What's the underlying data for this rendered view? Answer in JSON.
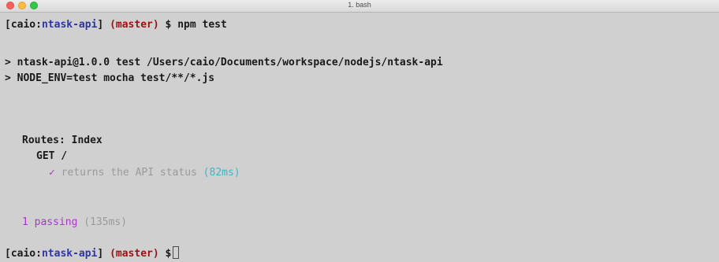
{
  "window": {
    "title": "1. bash",
    "colors": {
      "close": "#fc605c",
      "minimize": "#fdbc40",
      "maximize": "#34c84a"
    }
  },
  "terminal": {
    "prompt1": {
      "open": "[",
      "user": "caio",
      "sep": ":",
      "dir": "ntask-api",
      "close": "]",
      "branch": "(master)",
      "dollar": "$",
      "command": "npm test"
    },
    "script_lines": [
      "> ntask-api@1.0.0 test /Users/caio/Documents/workspace/nodejs/ntask-api",
      "> NODE_ENV=test mocha test/**/*.js"
    ],
    "suite": "Routes: Index",
    "subsuite": "GET /",
    "test": {
      "check": "✓",
      "name": "returns the API status",
      "duration": "(82ms)"
    },
    "summary": {
      "passing": "1 passing",
      "duration": "(135ms)"
    },
    "prompt2": {
      "open": "[",
      "user": "caio",
      "sep": ":",
      "dir": "ntask-api",
      "close": "]",
      "branch": "(master)",
      "dollar": "$"
    },
    "colors": {
      "dir": "#2d35a8",
      "branch": "#9c1212",
      "check": "#a638c7",
      "duration": "#38b7c9",
      "muted": "#9a9a9a"
    }
  }
}
